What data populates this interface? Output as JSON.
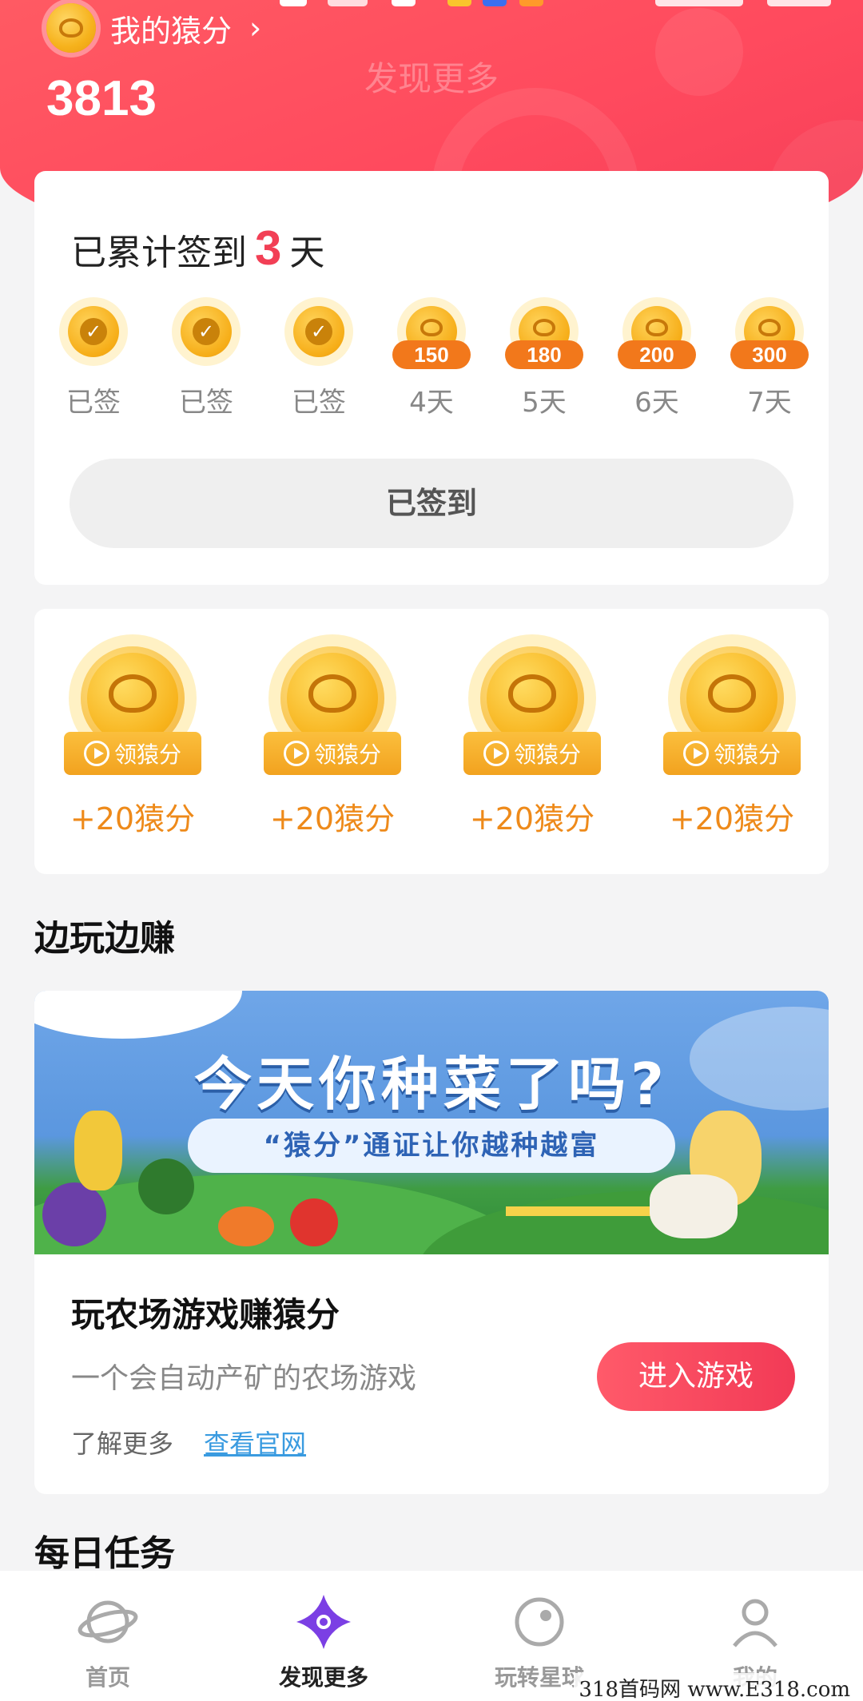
{
  "header": {
    "title": "我的猿分",
    "arrow": "›",
    "points": "3813",
    "faded_title": "发现更多"
  },
  "signin": {
    "title_prefix": "已累计签到",
    "count": "3",
    "title_suffix": "天",
    "days": [
      {
        "label": "已签",
        "signed": true,
        "reward": ""
      },
      {
        "label": "已签",
        "signed": true,
        "reward": ""
      },
      {
        "label": "已签",
        "signed": true,
        "reward": ""
      },
      {
        "label": "4天",
        "signed": false,
        "reward": "150"
      },
      {
        "label": "5天",
        "signed": false,
        "reward": "180"
      },
      {
        "label": "6天",
        "signed": false,
        "reward": "200"
      },
      {
        "label": "7天",
        "signed": false,
        "reward": "300"
      }
    ],
    "button_label": "已签到"
  },
  "rewards": {
    "items": [
      {
        "button": "领猿分",
        "amount": "+20猿分"
      },
      {
        "button": "领猿分",
        "amount": "+20猿分"
      },
      {
        "button": "领猿分",
        "amount": "+20猿分"
      },
      {
        "button": "领猿分",
        "amount": "+20猿分"
      }
    ]
  },
  "play_earn": {
    "section_title": "边玩边赚",
    "banner_title": "今天你种菜了吗?",
    "banner_subtitle": "“猿分”通证让你越种越富",
    "game_title": "玩农场游戏赚猿分",
    "game_subtitle": "一个会自动产矿的农场游戏",
    "learn_more": "了解更多",
    "official_site": "查看官网",
    "enter_button": "进入游戏"
  },
  "daily_tasks": {
    "section_title": "每日任务"
  },
  "tabbar": {
    "tabs": [
      {
        "label": "首页",
        "icon": "planet-icon",
        "active": false
      },
      {
        "label": "发现更多",
        "icon": "discover-diamond-icon",
        "active": true
      },
      {
        "label": "玩转星球",
        "icon": "orbit-icon",
        "active": false
      },
      {
        "label": "我的",
        "icon": "person-icon",
        "active": false
      }
    ]
  },
  "watermark": "318首码网 www.E318.com",
  "colors": {
    "header_red": "#ff4a5e",
    "accent_red": "#f23f55",
    "coin_gold": "#f6b21c",
    "reward_orange": "#ee8a1a",
    "link_blue": "#3a9be0",
    "tab_active_purple": "#7b3fe4"
  }
}
